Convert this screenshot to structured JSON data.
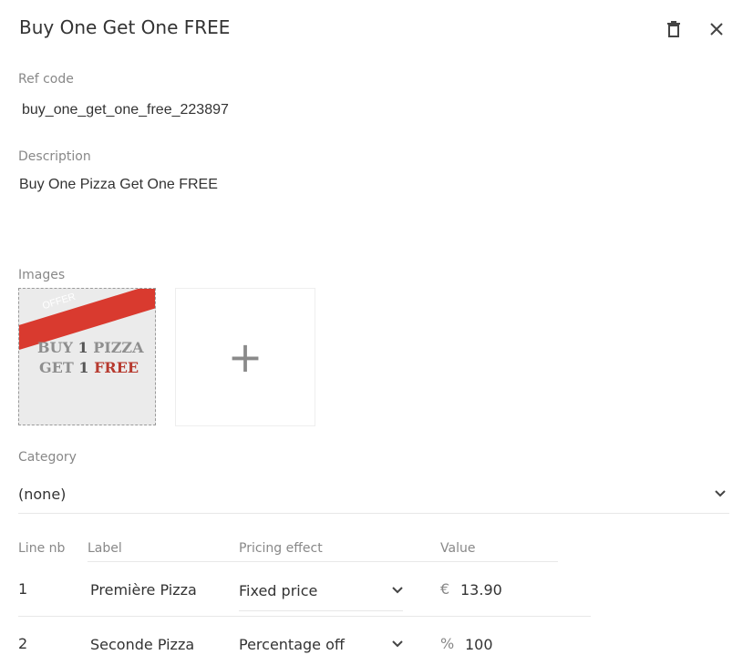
{
  "header": {
    "title": "Buy One Get One FREE"
  },
  "ref": {
    "label": "Ref code",
    "value": "buy_one_get_one_free_223897"
  },
  "description": {
    "label": "Description",
    "value": "Buy One Pizza Get One FREE"
  },
  "images": {
    "label": "Images",
    "offer_badge": "OFFER",
    "line1_a": "BUY",
    "line1_b": "1",
    "line1_c": "PIZZA",
    "line2_a": "GET",
    "line2_b": "1",
    "line2_c": "FREE"
  },
  "category": {
    "label": "Category",
    "value": "(none)"
  },
  "lines": {
    "headers": {
      "nb": "Line nb",
      "label": "Label",
      "pricing": "Pricing effect",
      "value": "Value"
    },
    "rows": [
      {
        "nb": "1",
        "label": "Première Pizza",
        "pricing": "Fixed price",
        "unit": "€",
        "value": "13.90"
      },
      {
        "nb": "2",
        "label": "Seconde Pizza",
        "pricing": "Percentage off",
        "unit": "%",
        "value": "100"
      }
    ]
  }
}
